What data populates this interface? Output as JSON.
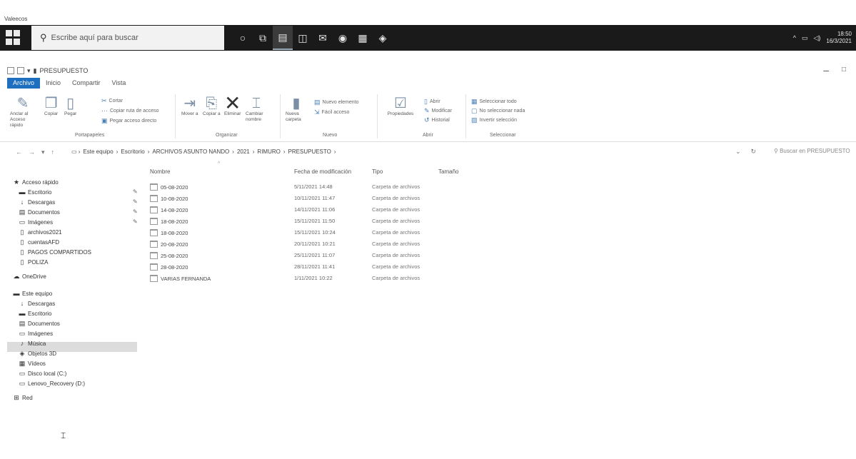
{
  "top_label": "Valeecos",
  "taskbar": {
    "search_placeholder": "Escribe aquí para buscar",
    "icons": [
      "cortana-icon",
      "task-view-icon",
      "file-explorer-icon",
      "store-icon",
      "mail-icon",
      "chrome-icon",
      "app-icon",
      "app2-icon"
    ],
    "clock_time": "18:50",
    "clock_date": "16/3/2021"
  },
  "window": {
    "title": "PRESUPUESTO",
    "minimize": "–",
    "maximize": "□"
  },
  "ribbon": {
    "tabs": [
      "Archivo",
      "Inicio",
      "Compartir",
      "Vista"
    ],
    "active_tab": "Archivo",
    "clipboard": {
      "pin_label": "Anclar al Acceso rápido",
      "copy_label": "Copiar",
      "paste_label": "Pegar",
      "cut_label": "Cortar",
      "copy_path_label": "Copiar ruta de acceso",
      "paste_shortcut_label": "Pegar acceso directo",
      "group_name": "Portapapeles"
    },
    "organize": {
      "move_label": "Mover a",
      "copy_to_label": "Copiar a",
      "delete_label": "Eliminar",
      "rename_label": "Cambiar nombre",
      "group_name": "Organizar"
    },
    "new": {
      "new_folder_label": "Nueva carpeta",
      "new_item_label": "Nuevo elemento",
      "easy_access_label": "Fácil acceso",
      "group_name": "Nuevo"
    },
    "open": {
      "properties_label": "Propiedades",
      "open_label": "Abrir",
      "edit_label": "Modificar",
      "history_label": "Historial",
      "group_name": "Abrir"
    },
    "select": {
      "select_all": "Seleccionar todo",
      "select_none": "No seleccionar nada",
      "invert": "Invertir selección",
      "group_name": "Seleccionar"
    }
  },
  "address": {
    "breadcrumb": [
      "Este equipo",
      "Escritorio",
      "ARCHIVOS ASUNTO NANDO",
      "2021",
      "RIMURO",
      "PRESUPUESTO"
    ],
    "search_placeholder": "Buscar en PRESUPUESTO"
  },
  "nav": {
    "quick_access": "Acceso rápido",
    "quick": [
      "Escritorio",
      "Descargas",
      "Documentos",
      "Imágenes",
      "archivos2021",
      "cuentasAFD",
      "PAGOS COMPARTIDOS",
      "POLIZA"
    ],
    "onedrive": "OneDrive",
    "this_pc": "Este equipo",
    "pc": [
      "Descargas",
      "Escritorio",
      "Documentos",
      "Imágenes",
      "Música",
      "Objetos 3D",
      "Vídeos",
      "Disco local (C:)",
      "Lenovo_Recovery (D:)"
    ],
    "network": "Red"
  },
  "columns": {
    "name": "Nombre",
    "date": "Fecha de modificación",
    "type": "Tipo",
    "size": "Tamaño"
  },
  "files": [
    {
      "name": "05-08-2020",
      "date": "5/11/2021 14:48",
      "type": "Carpeta de archivos"
    },
    {
      "name": "10-08-2020",
      "date": "10/11/2021 11:47",
      "type": "Carpeta de archivos"
    },
    {
      "name": "14-08-2020",
      "date": "14/11/2021 11:06",
      "type": "Carpeta de archivos"
    },
    {
      "name": "18-08-2020",
      "date": "15/11/2021 11:50",
      "type": "Carpeta de archivos"
    },
    {
      "name": "18-08-2020",
      "date": "15/11/2021 10:24",
      "type": "Carpeta de archivos"
    },
    {
      "name": "20-08-2020",
      "date": "20/11/2021 10:21",
      "type": "Carpeta de archivos"
    },
    {
      "name": "25-08-2020",
      "date": "25/11/2021 11:07",
      "type": "Carpeta de archivos"
    },
    {
      "name": "28-08-2020",
      "date": "28/11/2021 11:41",
      "type": "Carpeta de archivos"
    },
    {
      "name": "VARIAS FERNANDA",
      "date": "1/11/2021 10:22",
      "type": "Carpeta de archivos"
    }
  ]
}
